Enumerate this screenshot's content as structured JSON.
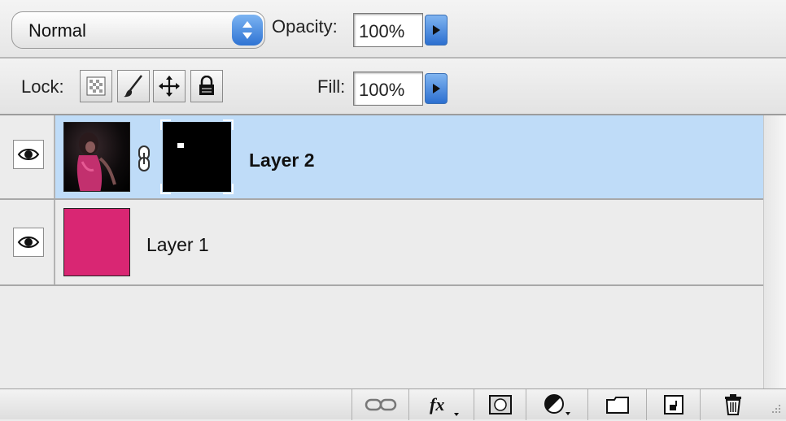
{
  "toolbar": {
    "blend_mode": "Normal",
    "opacity_label": "Opacity:",
    "opacity_value": "100%",
    "lock_label": "Lock:",
    "fill_label": "Fill:",
    "fill_value": "100%"
  },
  "layers": [
    {
      "name": "Layer 2",
      "selected": true,
      "visible": true,
      "has_mask": true
    },
    {
      "name": "Layer 1",
      "selected": false,
      "visible": true,
      "fill_color": "#d92673"
    }
  ],
  "colors": {
    "selection": "#bfdcf8",
    "layer1_fill": "#d92673",
    "accent_blue": "#2f73d3"
  },
  "bottom_icons": [
    "link-layers-icon",
    "fx-layer-style-icon",
    "add-mask-icon",
    "adjustment-layer-icon",
    "new-group-icon",
    "new-layer-icon",
    "trash-icon"
  ]
}
